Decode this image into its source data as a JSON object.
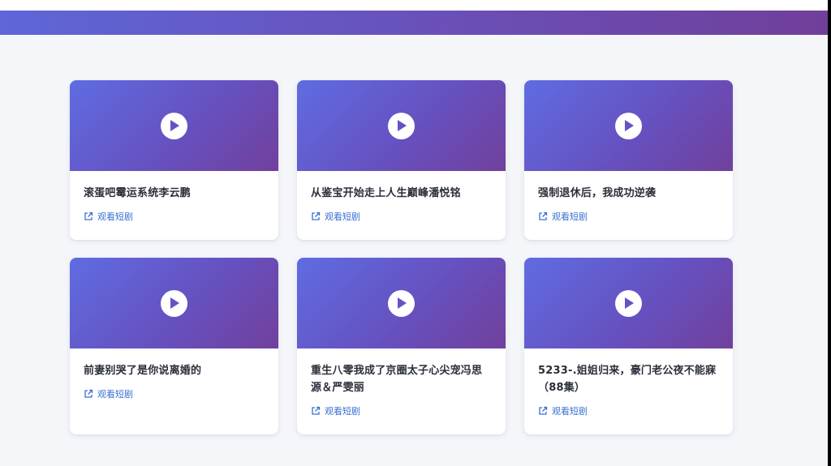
{
  "colors": {
    "header_start": "#5e66d8",
    "header_end": "#703f9a",
    "title_text": "#2b2f3a",
    "link_text": "#3a6fd0",
    "page_bg": "#f4f6fa"
  },
  "icons": {
    "thumbnail": "play-icon",
    "link": "external-link-icon"
  },
  "cards": [
    {
      "title": "滚蛋吧霉运系统李云鹏",
      "link_label": "观看短剧"
    },
    {
      "title": "从鉴宝开始走上人生巅峰潘悦铭",
      "link_label": "观看短剧"
    },
    {
      "title": "强制退休后，我成功逆袭",
      "link_label": "观看短剧"
    },
    {
      "title": "前妻别哭了是你说离婚的",
      "link_label": "观看短剧"
    },
    {
      "title": "重生八零我成了京圈太子心尖宠冯思源＆严雯丽",
      "link_label": "观看短剧"
    },
    {
      "title": "5233-.姐姐归来，豪门老公夜不能寐（88集）",
      "link_label": "观看短剧"
    }
  ]
}
